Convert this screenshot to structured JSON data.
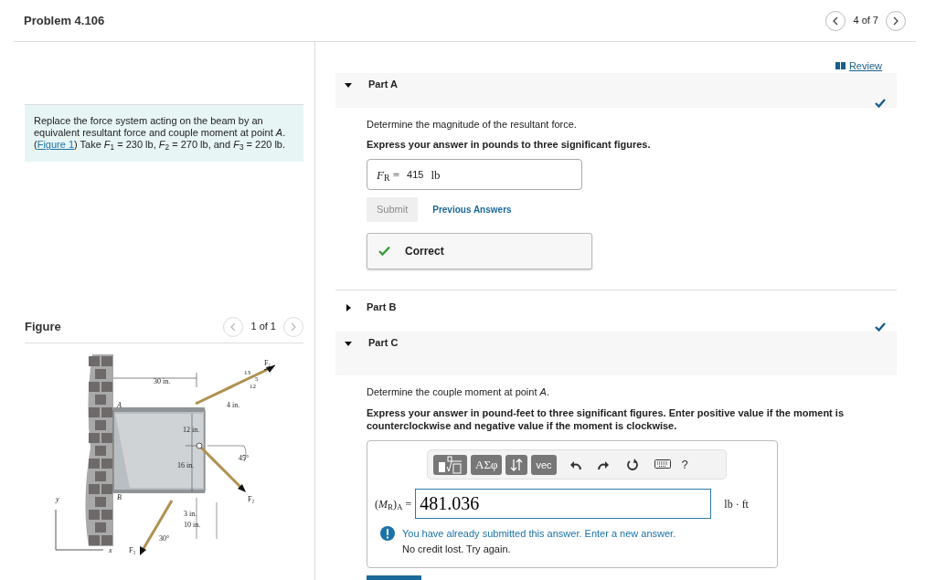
{
  "header": {
    "title": "Problem 4.106",
    "position": "4 of 7"
  },
  "problem": {
    "intro": "Replace the force system acting on the beam by an equivalent resultant force and couple moment at point *A*. (",
    "link": "Figure 1",
    "rest": ") Take *F*$_{1}$ = 230 lb, *F*$_{2}$ = 270 lb, and *F*$_{3}$ = 220 lb."
  },
  "figure": {
    "title": "Figure",
    "position": "1 of 1",
    "labels": [
      "30 in.",
      "A",
      "4 in.",
      "F₁",
      "13",
      "5",
      "12",
      "12 in.",
      "45°",
      "16 in.",
      "y",
      "B",
      "F₂",
      "3 in.",
      "10 in.",
      "30°",
      "x",
      "F₃"
    ]
  },
  "review": "Review",
  "parts": [
    {
      "kind": "answered",
      "label": "Part A",
      "expanded": true,
      "completed": true,
      "prompt": "Determine the magnitude of the resultant force.",
      "instruction": "Express your answer in pounds to three significant figures.",
      "answer": {
        "variable": "*F*$_{R}$ =",
        "value": "415",
        "unit": "lb"
      },
      "submit": {
        "label": "Submit",
        "disabled": true
      },
      "previous_answers": "Previous Answers",
      "feedback": {
        "kind": "correct",
        "text": "Correct"
      }
    },
    {
      "kind": "collapsed",
      "label": "Part B",
      "expanded": false,
      "completed": true
    },
    {
      "kind": "input",
      "label": "Part C",
      "expanded": true,
      "completed": false,
      "prompt": "Determine the couple moment at point *A*.",
      "instruction": "Express your answer in pound-feet to three significant figures. Enter positive value if the moment is counterclockwise and negative value if the moment is clockwise.",
      "toolbar": [
        {
          "kind": "template"
        },
        {
          "kind": "symbols",
          "label": "ΑΣφ"
        },
        {
          "kind": "swap"
        },
        {
          "kind": "vector",
          "label": "vec"
        },
        {
          "kind": "undo"
        },
        {
          "kind": "redo"
        },
        {
          "kind": "reset"
        },
        {
          "kind": "keyboard"
        },
        {
          "kind": "help",
          "label": "?"
        }
      ],
      "input": {
        "variable": "(*M*$_{R}$)$_{A}$ =",
        "value": "481.036",
        "unit": "lb · ft"
      },
      "feedback": {
        "kind": "warning",
        "text": "You have already submitted this answer. Enter a new answer.",
        "detail": "No credit lost. Try again."
      }
    }
  ]
}
